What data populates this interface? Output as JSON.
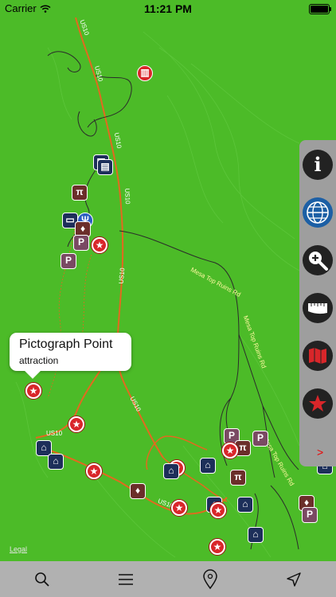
{
  "status": {
    "carrier": "Carrier",
    "time": "11:21 PM"
  },
  "callout": {
    "title": "Pictograph Point",
    "subtitle": "attraction"
  },
  "legal": "Legal",
  "roads": {
    "us10": "US10"
  },
  "trails": {
    "mesa_top": "Mesa Top Ruins Rd"
  },
  "side_panel": {
    "expand_label": ">"
  },
  "tabs": [
    "search",
    "list",
    "location-pin",
    "navigate"
  ],
  "colors": {
    "map_bg": "#4cbb28",
    "road": "#e26a1f",
    "poi_red": "#d9262a",
    "panel": "#9e9e9e",
    "tabbar": "#b1b1b1"
  }
}
